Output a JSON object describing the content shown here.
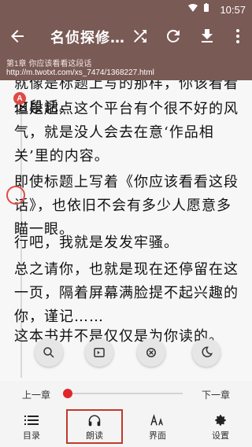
{
  "status": {
    "time": "10:57"
  },
  "toolbar": {
    "title": "名侦探修…",
    "icons": [
      "back-arrow-icon",
      "shuffle-icon",
      "refresh-icon",
      "download-icon",
      "more-icon"
    ]
  },
  "subinfo": {
    "chapter": "第1章 你应该看看这段话",
    "url": "http://m.twotxt.com/xs_7474/1368227.html"
  },
  "reader": {
    "p1": "就像是标题上写的那样，你该看看这段话。",
    "p2": "但是起点这个平台有个很不好的风气，就是没人会去在意‘作品相关’里的内容。",
    "p3": "即使标题上写着《你应该看看这段话》，也依旧不会有多少人愿意多瞄一眼。",
    "p4": "行吧，我就是发发牢骚。",
    "p5": "总之请你，也就是现在还停留在这一页，隔着屏幕满脸提不起兴趣的你，谨记……",
    "p6": "这本书并不是仅仅是为你读的。",
    "side_badge": "A"
  },
  "controls": {
    "prev_chapter": "上一章",
    "next_chapter": "下一章",
    "progress": 0,
    "menu": [
      {
        "label": "目录",
        "icon": "list-icon"
      },
      {
        "label": "朗读",
        "icon": "headphones-icon"
      },
      {
        "label": "界面",
        "icon": "font-aa-icon"
      },
      {
        "label": "设置",
        "icon": "gear-icon"
      }
    ]
  }
}
